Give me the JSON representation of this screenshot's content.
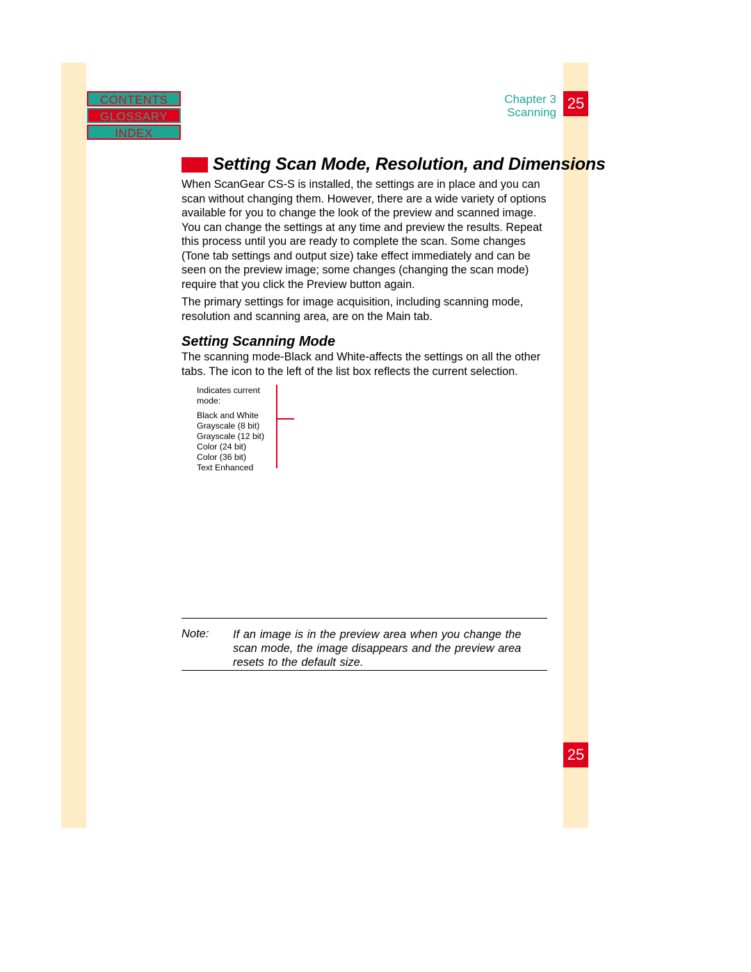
{
  "nav": {
    "contents": "CONTENTS",
    "glossary": "GLOSSARY",
    "index": "INDEX"
  },
  "header": {
    "chapter": "Chapter 3",
    "section": "Scanning",
    "page": "25"
  },
  "heading": "Setting Scan Mode, Resolution, and Dimensions",
  "paragraphs": {
    "p1": "When ScanGear CS-S is installed, the settings are in place and you can scan without changing them. However, there are a wide variety of options available for you to change the look of the preview and scanned image. You can change the settings at any time and preview the results. Repeat this process until you are ready to complete the scan. Some changes (Tone tab settings and output size) take effect immediately and can be seen on the preview image; some changes (changing the scan mode) require that you click the Preview button again.",
    "p2": "The primary settings for image acquisition, including scanning mode, resolution and scanning area, are on the Main tab.",
    "p3": "The scanning mode-Black and White-affects the settings on all the other tabs. The icon to the left of the list box reflects the current selection."
  },
  "subheading": "Setting Scanning Mode",
  "callout": {
    "intro": "Indicates current mode:",
    "modes": [
      "Black and White",
      "Grayscale (8 bit)",
      "Grayscale (12 bit)",
      "Color (24 bit)",
      "Color (36 bit)",
      "Text Enhanced"
    ]
  },
  "note": {
    "label": "Note:",
    "text": "If an image is in the preview area when you change the scan mode, the image disappears and the preview area resets to the default size."
  },
  "footer": {
    "page": "25"
  }
}
